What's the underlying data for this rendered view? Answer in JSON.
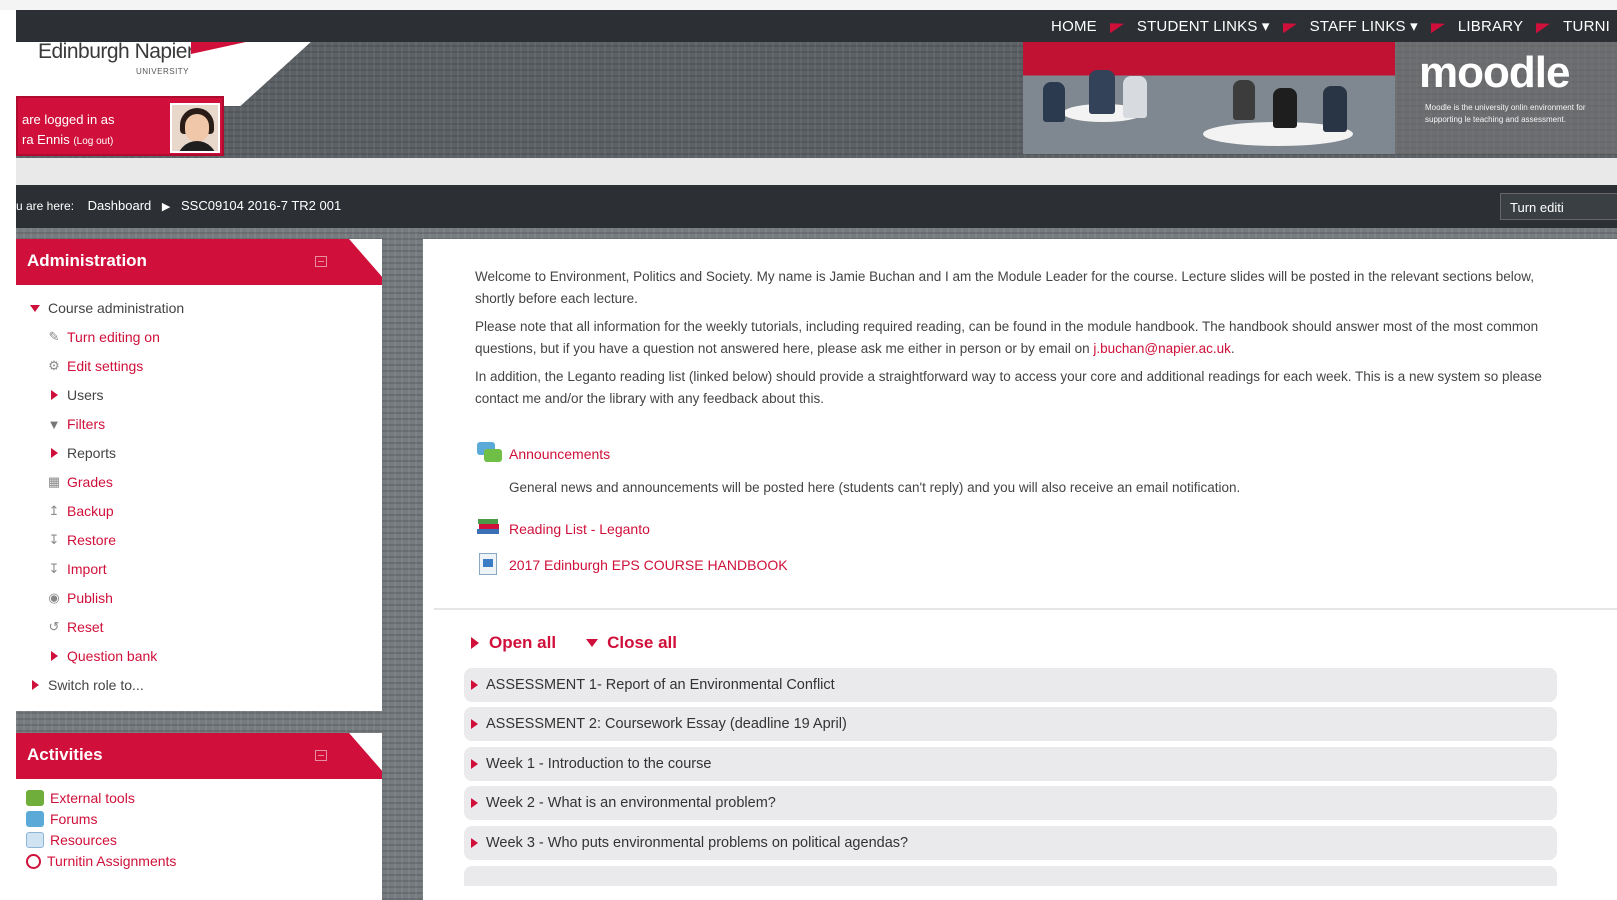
{
  "header": {
    "logo_name": "Edinburgh Napier",
    "logo_sub": "UNIVERSITY",
    "nav": [
      "HOME",
      "STUDENT LINKS ▾",
      "STAFF LINKS ▾",
      "LIBRARY",
      "TURNI"
    ],
    "login_line1": "are logged in as",
    "login_name": "ra Ennis",
    "logout": "(Log out)",
    "moodle_logo": "moodle",
    "moodle_tagline": "Moodle is the university onlin environment for supporting le teaching and assessment."
  },
  "breadcrumb": {
    "prefix": "u are here:",
    "items": [
      "Dashboard",
      "SSC09104 2016-7 TR2 001"
    ],
    "separator": "▶",
    "edit_button": "Turn editi"
  },
  "admin": {
    "title": "Administration",
    "course_admin": "Course administration",
    "items": [
      {
        "label": "Turn editing on",
        "icon": "pencil-icon"
      },
      {
        "label": "Edit settings",
        "icon": "gear-icon"
      },
      {
        "label": "Users",
        "icon": "expand-triangle-icon"
      },
      {
        "label": "Filters",
        "icon": "filter-icon"
      },
      {
        "label": "Reports",
        "icon": "expand-triangle-icon"
      },
      {
        "label": "Grades",
        "icon": "grades-table-icon"
      },
      {
        "label": "Backup",
        "icon": "upload-icon"
      },
      {
        "label": "Restore",
        "icon": "download-icon"
      },
      {
        "label": "Import",
        "icon": "download-icon"
      },
      {
        "label": "Publish",
        "icon": "globe-icon"
      },
      {
        "label": "Reset",
        "icon": "reset-icon"
      },
      {
        "label": "Question bank",
        "icon": "expand-triangle-icon"
      }
    ],
    "switch_role": "Switch role to..."
  },
  "activities": {
    "title": "Activities",
    "items": [
      {
        "label": "External tools",
        "icon": "puzzle-icon"
      },
      {
        "label": "Forums",
        "icon": "forum-icon"
      },
      {
        "label": "Resources",
        "icon": "file-icon"
      },
      {
        "label": "Turnitin Assignments",
        "icon": "turnitin-icon"
      }
    ]
  },
  "content": {
    "intro1": "Welcome to Environment, Politics and Society. My name is Jamie Buchan and I am the Module Leader for the course. Lecture slides will be posted in the relevant sections below, shortly before each lecture.",
    "intro2": "Please note that all information for the weekly tutorials, including required reading, can be found in the module handbook. The handbook should answer most of the most common questions, but if you have a question not answered here, please ask me either in person or by email on ",
    "email": "j.buchan@napier.ac.uk",
    "intro2_end": ".",
    "intro3": "In addition, the Leganto reading list (linked below) should provide a straightforward way to access your core and additional readings for each week. This is a new system so please contact me and/or the library with any feedback about this.",
    "announcements": "Announcements",
    "announcements_desc": "General news and announcements will be posted here (students can't reply) and you will also receive an email notification.",
    "reading_list": "Reading List - Leganto",
    "handbook": "2017 Edinburgh EPS COURSE HANDBOOK",
    "open_all": "Open all",
    "close_all": "Close all",
    "sections": [
      "ASSESSMENT 1- Report of an Environmental Conflict",
      "ASSESSMENT 2: Coursework Essay (deadline 19 April)",
      "Week 1 - Introduction to the course",
      "Week 2 - What is an environmental problem?",
      "Week 3 - Who puts environmental problems on political agendas?"
    ]
  },
  "colors": {
    "accent": "#d0103a",
    "dark_bar": "#2c3034"
  }
}
